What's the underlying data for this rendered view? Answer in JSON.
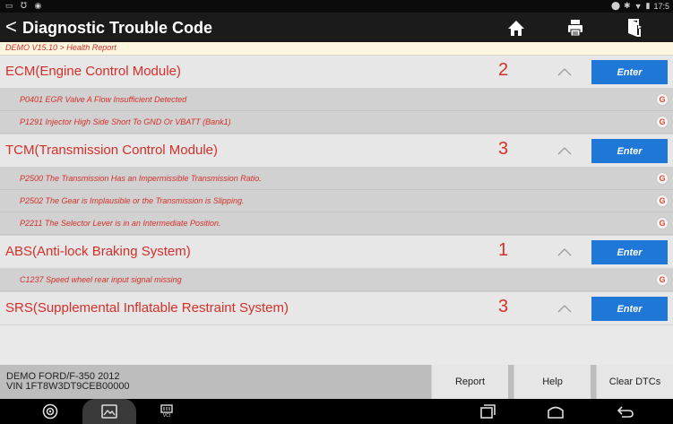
{
  "status_bar": {
    "left_icons": [
      "screen-icon",
      "headset-icon",
      "app-icon"
    ],
    "time": "17:5"
  },
  "header": {
    "back_label": "<",
    "title": "Diagnostic Trouble Code",
    "icons": [
      "home-icon",
      "print-icon",
      "exit-icon"
    ]
  },
  "breadcrumb": "DEMO V15.10 > Health Report",
  "modules": [
    {
      "name": "ECM(Engine Control Module)",
      "count": "2",
      "button": "Enter",
      "dtcs": [
        "P0401 EGR Valve A Flow Insufficient Detected",
        "P1291 Injector High Side Short To GND Or VBATT (Bank1)"
      ]
    },
    {
      "name": "TCM(Transmission Control Module)",
      "count": "3",
      "button": "Enter",
      "dtcs": [
        "P2500 The Transmission Has an Impermissible Transmission Ratio.",
        "P2502 The Gear is Implausible or the Transmission is Slipping.",
        "P2211 The Selector Lever is in an Intermediate Position."
      ]
    },
    {
      "name": "ABS(Anti-lock Braking System)",
      "count": "1",
      "button": "Enter",
      "dtcs": [
        "C1237 Speed wheel rear input signal missing"
      ]
    },
    {
      "name": "SRS(Supplemental Inflatable Restraint System)",
      "count": "3",
      "button": "Enter",
      "dtcs": []
    }
  ],
  "dtc_search_icon": "G",
  "footer": {
    "vehicle_line1": "DEMO FORD/F-350 2012",
    "vehicle_line2": "VIN 1FT8W3DT9CEB00000",
    "buttons": [
      "Report",
      "Help",
      "Clear DTCs"
    ]
  },
  "nav_bar": {
    "vci_label": "VCI"
  },
  "colors": {
    "accent_red": "#d3302a",
    "enter_blue": "#1f77d8",
    "topbar": "#1b1b1b"
  }
}
